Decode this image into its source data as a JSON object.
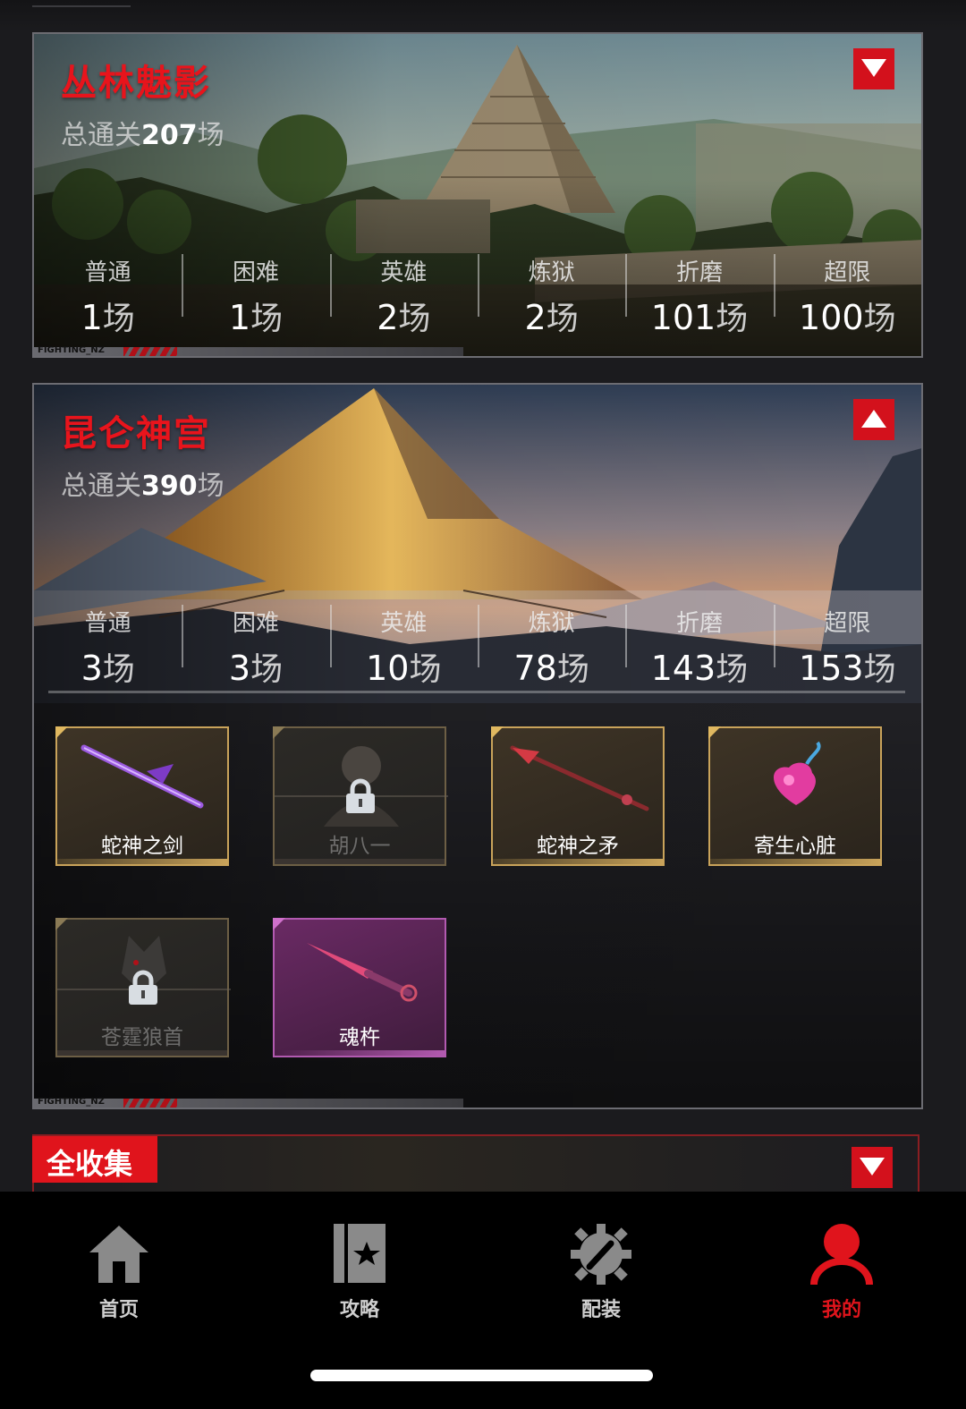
{
  "maps": [
    {
      "title": "丛林魅影",
      "total_prefix": "总通关",
      "total_count": "207",
      "total_unit": "场",
      "expanded": false,
      "footer_tag": "FIGHTING_NZ",
      "levels": [
        {
          "name": "普通",
          "count": "1",
          "unit": "场"
        },
        {
          "name": "困难",
          "count": "1",
          "unit": "场"
        },
        {
          "name": "英雄",
          "count": "2",
          "unit": "场"
        },
        {
          "name": "炼狱",
          "count": "2",
          "unit": "场"
        },
        {
          "name": "折磨",
          "count": "101",
          "unit": "场"
        },
        {
          "name": "超限",
          "count": "100",
          "unit": "场"
        }
      ]
    },
    {
      "title": "昆仑神宫",
      "total_prefix": "总通关",
      "total_count": "390",
      "total_unit": "场",
      "expanded": true,
      "footer_tag": "FIGHTING_NZ",
      "levels": [
        {
          "name": "普通",
          "count": "3",
          "unit": "场"
        },
        {
          "name": "困难",
          "count": "3",
          "unit": "场"
        },
        {
          "name": "英雄",
          "count": "10",
          "unit": "场"
        },
        {
          "name": "炼狱",
          "count": "78",
          "unit": "场"
        },
        {
          "name": "折磨",
          "count": "143",
          "unit": "场"
        },
        {
          "name": "超限",
          "count": "153",
          "unit": "场"
        }
      ],
      "rewards": [
        {
          "name": "蛇神之剑",
          "locked": false,
          "rarity": "gold",
          "icon": "sword-icon"
        },
        {
          "name": "胡八一",
          "locked": true,
          "rarity": "gold",
          "icon": "character-icon"
        },
        {
          "name": "蛇神之矛",
          "locked": false,
          "rarity": "gold",
          "icon": "spear-icon"
        },
        {
          "name": "寄生心脏",
          "locked": false,
          "rarity": "gold",
          "icon": "heart-icon"
        },
        {
          "name": "苍霆狼首",
          "locked": true,
          "rarity": "gold",
          "icon": "wolf-head-icon"
        },
        {
          "name": "魂杵",
          "locked": false,
          "rarity": "purple",
          "icon": "dagger-icon"
        }
      ]
    }
  ],
  "collection": {
    "title": "全收集",
    "expanded": false
  },
  "tabbar": [
    {
      "label": "首页",
      "icon": "home-icon",
      "active": false
    },
    {
      "label": "攻略",
      "icon": "guide-book-icon",
      "active": false
    },
    {
      "label": "配装",
      "icon": "gear-wrench-icon",
      "active": false
    },
    {
      "label": "我的",
      "icon": "profile-icon",
      "active": true
    }
  ],
  "colors": {
    "accent": "#e0141c",
    "gold_border": "#c9a35a",
    "purple_border": "#b25ab0",
    "background": "#1b1b1e"
  }
}
